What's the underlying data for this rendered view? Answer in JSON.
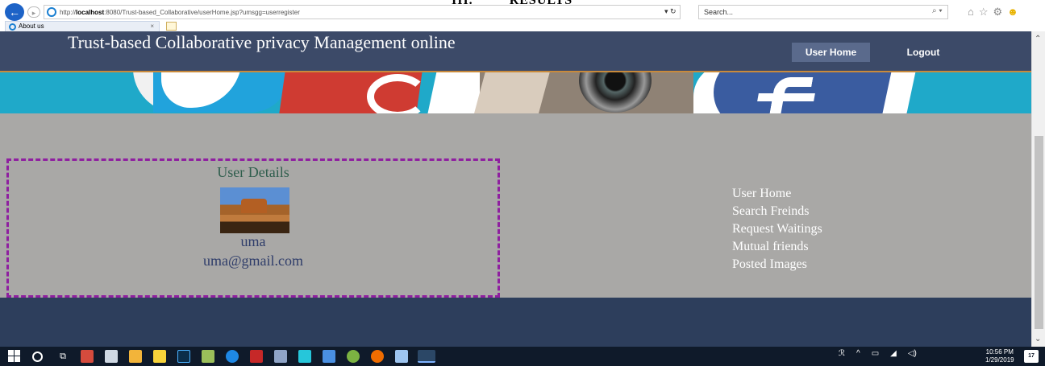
{
  "document_heading": {
    "number": "III.",
    "text": "RESULTS"
  },
  "browser": {
    "back_icon": "←",
    "url_prefix": "http://",
    "url_host": "localhost",
    "url_rest": ":8080/Trust-based_Collaborative/userHome.jsp?umsgg=userregister",
    "refresh_label": "▾ ↻",
    "search_placeholder": "Search...",
    "search_icon": "⌕ ▾",
    "tab_title": "About us",
    "tab_close": "×"
  },
  "site": {
    "title": "Trust-based Collaborative privacy Management online",
    "nav": {
      "home": "User Home",
      "logout": "Logout"
    }
  },
  "user_details": {
    "title": "User Details",
    "name": "uma",
    "email": "uma@gmail.com"
  },
  "menu": {
    "items": [
      "User Home",
      "Search Freinds",
      "Request Waitings",
      "Mutual friends",
      "Posted Images"
    ]
  },
  "taskbar": {
    "time": "10:56 PM",
    "date": "1/29/2019",
    "notifications": "17"
  },
  "colors": {
    "header_bg": "#3c4a68",
    "content_bg": "#a9a8a6",
    "box_border": "#8f1fa0",
    "footer_bg": "#2d3e5c"
  }
}
